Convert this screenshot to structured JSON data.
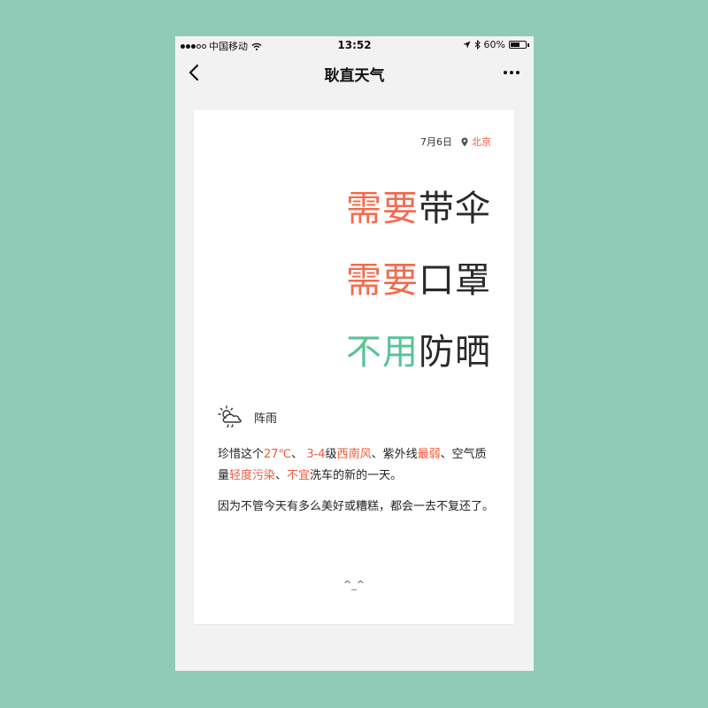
{
  "status_bar": {
    "carrier": "中国移动",
    "time": "13:52",
    "battery": "60%",
    "battery_level": 0.6
  },
  "nav": {
    "title": "耿直天气",
    "back_icon": "chevron-left-icon",
    "more_icon": "more-dots-icon"
  },
  "card": {
    "date": "7月6日",
    "city": "北京",
    "advice": [
      {
        "verdict": "需要",
        "item": "带伞",
        "verdict_color": "#f46a4d"
      },
      {
        "verdict": "需要",
        "item": "口罩",
        "verdict_color": "#f46a4d"
      },
      {
        "verdict": "不用",
        "item": "防晒",
        "verdict_color": "#5ac395"
      }
    ],
    "weather": {
      "icon": "shower-rain-icon",
      "condition": "阵雨"
    },
    "paragraph1": {
      "s1": "珍惜这个",
      "temp": "27℃",
      "s2": "、",
      "wind_level": "3-4",
      "s3": "级",
      "wind_dir": "西南风",
      "s4": "、紫外线",
      "uv": "最弱",
      "s5": "、空气质量",
      "air": "轻度污染",
      "s6": "、",
      "wash": "不宜",
      "s7": "洗车的新的一天。"
    },
    "paragraph2": "因为不管今天有多么美好或糟糕，都会一去不复还了。",
    "footer": "^_^"
  },
  "colors": {
    "background": "#90cbb8",
    "accent_red": "#f15a3a",
    "accent_green": "#5ac395"
  }
}
